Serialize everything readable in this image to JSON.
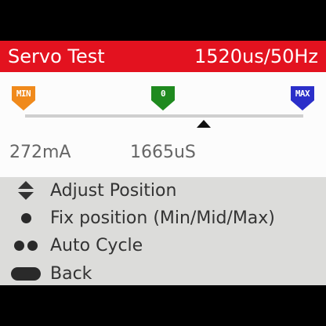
{
  "header": {
    "title": "Servo Test",
    "status": "1520us/50Hz",
    "background_color": "#e3121f"
  },
  "position_bar": {
    "markers": [
      {
        "label": "MIN",
        "color": "#f08a1c"
      },
      {
        "label": "0",
        "color": "#1f8a1f"
      },
      {
        "label": "MAX",
        "color": "#2b2fc9"
      }
    ],
    "pointer_position_fraction": 0.62
  },
  "readings": {
    "current": "272mA",
    "pulse": "1665uS"
  },
  "help": [
    {
      "icon": "up-down-arrows-icon",
      "label": "Adjust Position"
    },
    {
      "icon": "single-press-icon",
      "label": "Fix position (Min/Mid/Max)"
    },
    {
      "icon": "double-press-icon",
      "label": "Auto Cycle"
    },
    {
      "icon": "long-press-icon",
      "label": "Back"
    }
  ]
}
